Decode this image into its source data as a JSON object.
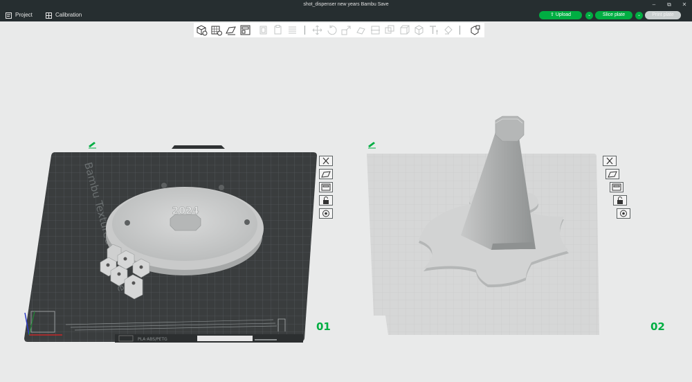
{
  "window": {
    "title": "shot_dispenser new years Bambu Save"
  },
  "menu": {
    "project_label": "Project",
    "calibration_label": "Calibration"
  },
  "actions": {
    "upload_label": "Upload",
    "slice_label": "Slice plate",
    "print_label": "Print plate"
  },
  "plates": [
    {
      "number": "01",
      "bed_title": "Bambu Textured PEI Plate",
      "part_text": "2024",
      "footer_text": "PLA·ABS/PETG"
    },
    {
      "number": "02"
    }
  ],
  "colors": {
    "accent": "#00ae42",
    "titlebar": "#262e30",
    "canvas": "#e9eaea",
    "bed_dark": "#3a3d3e",
    "bed_light": "#d6d7d7"
  }
}
